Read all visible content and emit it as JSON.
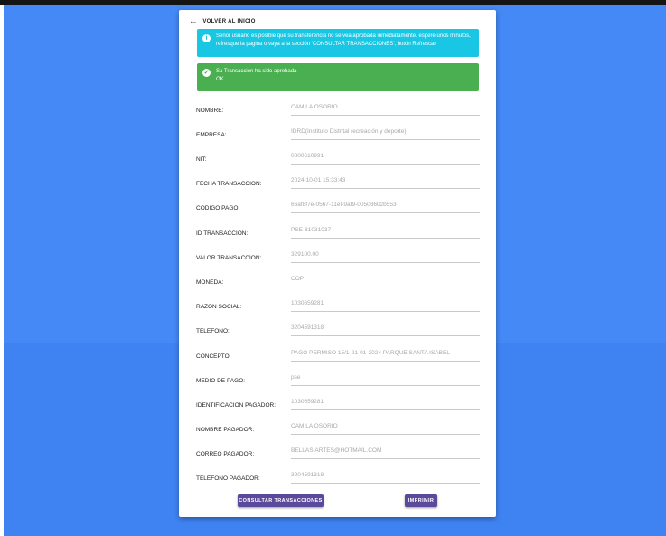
{
  "back_link": {
    "label": "VOLVER AL INICIO"
  },
  "info_alert": {
    "icon": "info-icon",
    "text": "Señor usuario es posible que su transferencia no se vea aprobada inmediatamente, espere unos minutos, refresque la pagina o vaya a la sección 'CONSULTAR TRANSACCIONES', botón Refrescar"
  },
  "success_alert": {
    "icon": "check-circle-icon",
    "title": "Su Transacción ha sido aprobada",
    "status": "OK"
  },
  "fields": [
    {
      "label": "NOMBRE:",
      "value": "CAMILA OSORIO"
    },
    {
      "label": "EMPRESA:",
      "value": "IDRD(Instituto Distrital recreación y deporte)"
    },
    {
      "label": "NIT:",
      "value": "0800610991"
    },
    {
      "label": "FECHA TRANSACCION:",
      "value": "2024-10-01 15:33:43"
    },
    {
      "label": "CODIGO PAGO:",
      "value": "66af8f7e-0567-11ef-9af9-00503602b553"
    },
    {
      "label": "ID TRANSACCION:",
      "value": "PSE-81031037"
    },
    {
      "label": "VALOR TRANSACCION:",
      "value": "329100.00"
    },
    {
      "label": "MONEDA:",
      "value": "COP"
    },
    {
      "label": "RAZON SOCIAL:",
      "value": "1030659281"
    },
    {
      "label": "TELEFONO:",
      "value": "3204591318"
    },
    {
      "label": "CONCEPTO:",
      "value": "PAGO PERMISO 15/1-21-01-2024 PARQUE SANTA ISABEL"
    },
    {
      "label": "MEDIO DE PAGO:",
      "value": "pse"
    },
    {
      "label": "IDENTIFICACION PAGADOR:",
      "value": "1030659281"
    },
    {
      "label": "NOMBRE PAGADOR:",
      "value": "CAMILA OSORIO"
    },
    {
      "label": "CORREO PAGADOR:",
      "value": "BELLAS.ARTES@HOTMAIL.COM"
    },
    {
      "label": "TELEFONO PAGADOR:",
      "value": "3204591318"
    }
  ],
  "buttons": {
    "consultar": "CONSULTAR TRANSACCIONES",
    "imprimir": "IMPRIMIR"
  },
  "colors": {
    "background": "#4589f6",
    "info": "#19c7e4",
    "success": "#4aaf50",
    "button": "#5b4a9b"
  }
}
